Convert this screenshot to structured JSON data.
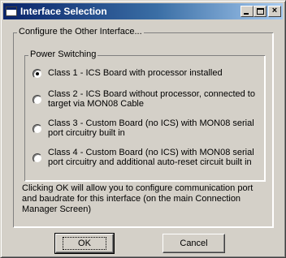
{
  "window": {
    "title": "Interface Selection",
    "controls": {
      "minimize": "minimize",
      "maximize": "maximize",
      "close": "×"
    }
  },
  "outer_group": {
    "legend": "Configure the Other Interface..."
  },
  "power_switching": {
    "legend": "Power Switching",
    "options": [
      {
        "label": "Class 1 - ICS Board with processor installed",
        "selected": true
      },
      {
        "label": "Class 2 -  ICS Board without processor, connected to target via MON08 Cable",
        "selected": false
      },
      {
        "label": "Class 3 - Custom Board (no ICS) with MON08 serial port circuitry built in",
        "selected": false
      },
      {
        "label": "Class 4 - Custom Board (no ICS) with MON08 serial port circuitry and additional auto-reset circuit built in",
        "selected": false
      }
    ]
  },
  "description": "Clicking OK will allow you to configure communication port and baudrate for this interface (on the main Connection Manager Screen)",
  "buttons": {
    "ok": "OK",
    "cancel": "Cancel"
  }
}
